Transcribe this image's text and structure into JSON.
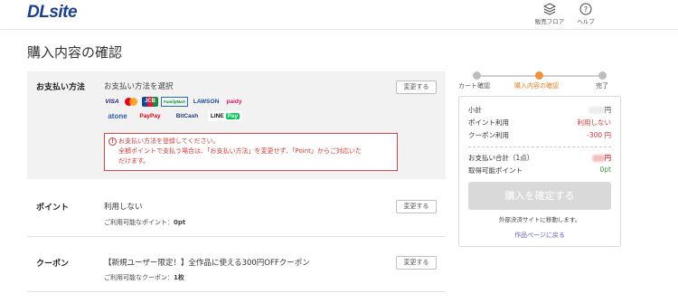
{
  "header": {
    "logo": "DLsite",
    "nav": [
      {
        "label": "販売フロア",
        "icon": "layers-icon"
      },
      {
        "label": "ヘルプ",
        "icon": "help-icon"
      }
    ]
  },
  "page_title": "購入内容の確認",
  "payment": {
    "label": "お支払い方法",
    "select_text": "お支払い方法を選択",
    "change_label": "変更する",
    "methods": [
      "VISA",
      "Mastercard",
      "JCB",
      "FamilyMart",
      "LAWSON",
      "paidy",
      "atone",
      "PayPay",
      "BitCash",
      "LINE Pay"
    ],
    "error_lines": [
      "お支払い方法を登録してください。",
      "全額ポイントで支払う場合は、「お支払い方法」を変更せず、「Point」からご対応いた",
      "だけます。"
    ]
  },
  "point": {
    "label": "ポイント",
    "value": "利用しない",
    "sub_prefix": "ご利用可能なポイント：",
    "sub_value": "0pt",
    "change_label": "変更する"
  },
  "coupon": {
    "label": "クーポン",
    "value": "【新規ユーザー限定！】全作品に使える300円OFFクーポン",
    "sub_prefix": "ご利用可能なクーポン：",
    "sub_value": "1枚",
    "change_label": "変更する"
  },
  "steps": [
    {
      "label": "カート確認",
      "active": false
    },
    {
      "label": "購入内容の確認",
      "active": true
    },
    {
      "label": "完了",
      "active": false
    }
  ],
  "summary": {
    "subtotal_label": "小計",
    "subtotal_suffix": "円",
    "points_label": "ポイント利用",
    "points_value": "利用しない",
    "coupon_label": "クーポン利用",
    "coupon_value": "-300 円",
    "total_label": "お支払い合計（1点）",
    "total_suffix": "円",
    "earn_label": "取得可能ポイント",
    "earn_value": "0pt",
    "confirm_label": "購入を確定する",
    "note": "外部決済サイトに移動します。",
    "link": "作品ページに戻る"
  },
  "colors": {
    "accent": "#f0923a",
    "error": "#d63838",
    "logo": "#1b3f8f",
    "green": "#3a9a3a",
    "link": "#5e5ec0"
  }
}
